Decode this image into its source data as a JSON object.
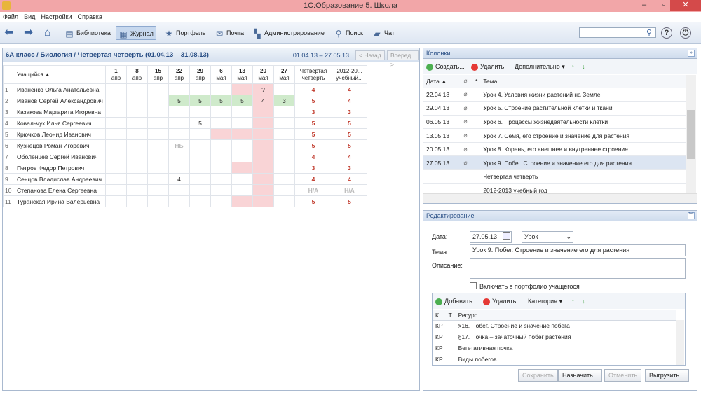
{
  "window": {
    "title": "1С:Образование 5. Школа",
    "minimize": "–",
    "maximize": "▫",
    "close": "✕"
  },
  "menu": [
    "Файл",
    "Вид",
    "Настройки",
    "Справка"
  ],
  "toolbar": {
    "library": "Библиотека",
    "journal": "Журнал",
    "portfolio": "Портфель",
    "mail": "Почта",
    "admin": "Администрирование",
    "search": "Поиск",
    "chat": "Чат",
    "search_placeholder": "",
    "help": "?",
    "power": "⏻"
  },
  "journal": {
    "title": "6А класс / Биология / Четвертая четверть (01.04.13 – 31.08.13)",
    "range": "01.04.13 – 27.05.13",
    "prev": "< Назад",
    "next": "Вперед >",
    "student_header": "Учащийся ▲",
    "dates": [
      [
        "1",
        "апр"
      ],
      [
        "8",
        "апр"
      ],
      [
        "15",
        "апр"
      ],
      [
        "22",
        "апр"
      ],
      [
        "29",
        "апр"
      ],
      [
        "6",
        "мая"
      ],
      [
        "13",
        "мая"
      ],
      [
        "20",
        "мая"
      ],
      [
        "27",
        "мая"
      ]
    ],
    "final_header": [
      "Четвертая",
      "четверть"
    ],
    "year_header": [
      "2012-20...",
      "учебный..."
    ],
    "students": [
      {
        "n": "1",
        "name": "Иваненко Ольга Анатольевна",
        "marks": [
          "",
          "",
          "",
          "",
          "",
          "",
          "",
          "?",
          ""
        ],
        "fin": "4",
        "year": "4"
      },
      {
        "n": "2",
        "name": "Иванов Сергей Александрович",
        "marks": [
          "",
          "",
          "",
          "5",
          "5",
          "5",
          "5",
          "4",
          "3"
        ],
        "fin": "5",
        "year": "4"
      },
      {
        "n": "3",
        "name": "Казакова Маргарита Игоревна",
        "marks": [
          "",
          "",
          "",
          "",
          "",
          "",
          "",
          "",
          ""
        ],
        "fin": "3",
        "year": "3"
      },
      {
        "n": "4",
        "name": "Ковальчук Илья Сергеевич",
        "marks": [
          "",
          "",
          "",
          "",
          "5",
          "",
          "",
          "",
          ""
        ],
        "fin": "5",
        "year": "5"
      },
      {
        "n": "5",
        "name": "Крючков Леонид Иванович",
        "marks": [
          "",
          "",
          "",
          "",
          "",
          "",
          "",
          "",
          ""
        ],
        "fin": "5",
        "year": "5"
      },
      {
        "n": "6",
        "name": "Кузнецов Роман Игоревич",
        "marks": [
          "",
          "",
          "",
          "НБ",
          "",
          "",
          "",
          "",
          ""
        ],
        "fin": "5",
        "year": "5"
      },
      {
        "n": "7",
        "name": "Оболенцев Сергей Иванович",
        "marks": [
          "",
          "",
          "",
          "",
          "",
          "",
          "",
          "",
          ""
        ],
        "fin": "4",
        "year": "4"
      },
      {
        "n": "8",
        "name": "Петров Федор Петрович",
        "marks": [
          "",
          "",
          "",
          "",
          "",
          "",
          "",
          "",
          ""
        ],
        "fin": "3",
        "year": "3"
      },
      {
        "n": "9",
        "name": "Сенцов Владислав Андреевич",
        "marks": [
          "",
          "",
          "",
          "4",
          "",
          "",
          "",
          "",
          ""
        ],
        "fin": "4",
        "year": "4"
      },
      {
        "n": "10",
        "name": "Степанова Елена Сергеевна",
        "marks": [
          "",
          "",
          "",
          "",
          "",
          "",
          "",
          "",
          ""
        ],
        "fin": "Н/А",
        "year": "Н/А"
      },
      {
        "n": "11",
        "name": "Туранская Ирина Валерьевна",
        "marks": [
          "",
          "",
          "",
          "",
          "",
          "",
          "",
          "",
          ""
        ],
        "fin": "5",
        "year": "5"
      }
    ]
  },
  "columns": {
    "title": "Колонки",
    "create": "Создать...",
    "delete": "Удалить",
    "more": "Дополнительно ▾",
    "h_date": "Дата ▲",
    "h_star": "*",
    "h_topic": "Тема",
    "rows": [
      {
        "date": "22.04.13",
        "topic": "Урок 4. Условия жизни растений на Земле",
        "clip": true
      },
      {
        "date": "29.04.13",
        "topic": "Урок 5. Строение растительной клетки и ткани",
        "clip": true
      },
      {
        "date": "06.05.13",
        "topic": "Урок 6. Процессы жизнедеятельности клетки",
        "clip": true
      },
      {
        "date": "13.05.13",
        "topic": "Урок 7. Семя, его строение и значение для растения",
        "clip": true
      },
      {
        "date": "20.05.13",
        "topic": "Урок 8. Корень, его внешнее и внутреннее строение",
        "clip": true
      },
      {
        "date": "27.05.13",
        "topic": "Урок 9. Побег. Строение и значение его для растения",
        "clip": true
      },
      {
        "date": "",
        "topic": "Четвертая четверть",
        "clip": false
      },
      {
        "date": "",
        "topic": "2012-2013 учебный год",
        "clip": false
      }
    ]
  },
  "edit": {
    "title": "Редактирование",
    "date_label": "Дата:",
    "date_value": "27.05.13",
    "type_value": "Урок",
    "topic_label": "Тема:",
    "topic_value": "Урок 9. Побег. Строение и значение его для растения",
    "desc_label": "Описание:",
    "portfolio_label": "Включать в портфолио учащегося",
    "add": "Добавить...",
    "delete": "Удалить",
    "category": "Категория ▾",
    "h_k": "К",
    "h_t": "Т",
    "h_res": "Ресурс",
    "resources": [
      {
        "k": "КР",
        "name": "§16. Побег. Строение и значение побега"
      },
      {
        "k": "КР",
        "name": "§17. Почка – зачаточный побег растения"
      },
      {
        "k": "КР",
        "name": "Вегетативная почка"
      },
      {
        "k": "КР",
        "name": "Виды побегов"
      }
    ],
    "save": "Сохранить",
    "assign": "Назначить...",
    "cancel": "Отменить",
    "export": "Выгрузить..."
  }
}
